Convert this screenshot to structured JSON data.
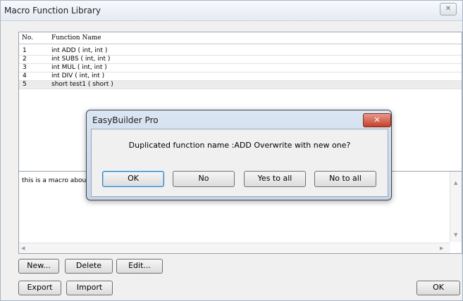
{
  "window": {
    "title": "Macro Function Library",
    "close_icon": "close-icon"
  },
  "table": {
    "columns": [
      "No.",
      "Function Name"
    ],
    "rows": [
      {
        "no": "1",
        "name": "int ADD ( int, int )"
      },
      {
        "no": "2",
        "name": "int SUBS ( int, int )"
      },
      {
        "no": "3",
        "name": "int MUL ( int, int )"
      },
      {
        "no": "4",
        "name": "int DIV ( int, int )"
      },
      {
        "no": "5",
        "name": "short test1 ( short )"
      }
    ]
  },
  "description": {
    "text": "this is a macro about s"
  },
  "buttons": {
    "new": "New...",
    "delete": "Delete",
    "edit": "Edit...",
    "export": "Export",
    "import": "Import",
    "ok": "OK"
  },
  "dialog": {
    "title": "EasyBuilder Pro",
    "message": "Duplicated function name :ADD Overwrite with new one?",
    "buttons": [
      "OK",
      "No",
      "Yes to all",
      "No to all"
    ],
    "close_icon": "close-icon"
  }
}
